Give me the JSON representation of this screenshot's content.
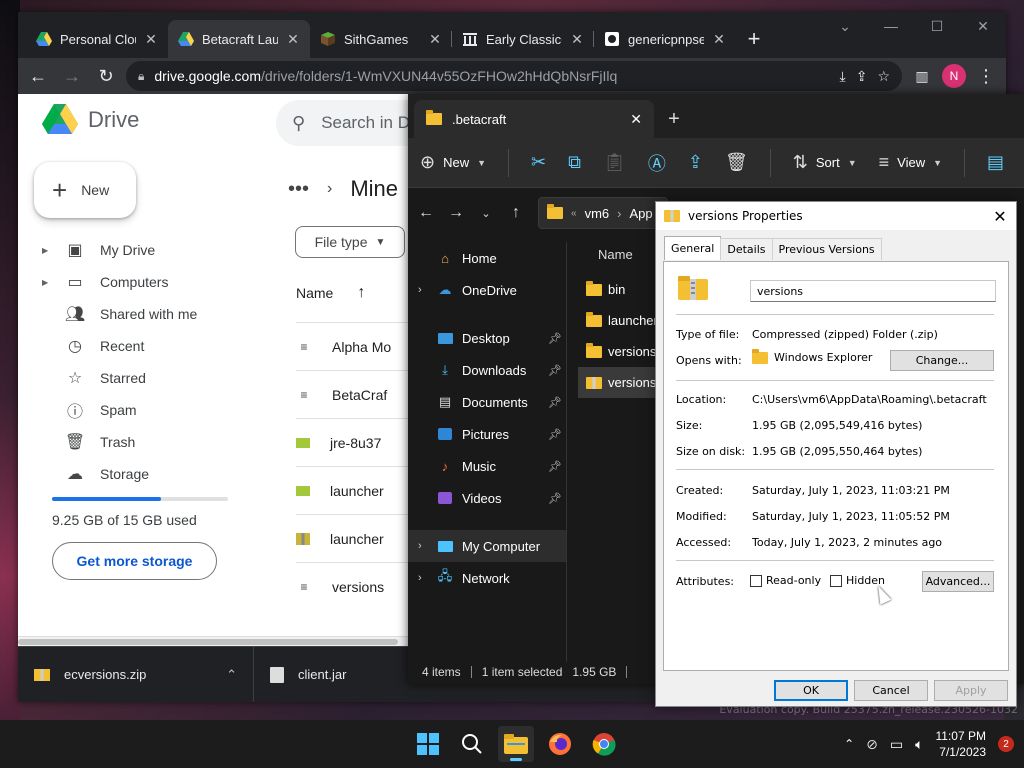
{
  "chrome": {
    "tabs": [
      {
        "title": "Personal Clouc"
      },
      {
        "title": "Betacraft Laun"
      },
      {
        "title": "SithGames"
      },
      {
        "title": "Early Classic+"
      },
      {
        "title": "genericpnpser"
      }
    ],
    "url_host": "drive.google.com",
    "url_path": "/drive/folders/1-WmVXUN44v55OzFHOw2hHdQbNsrFjIlq",
    "profile_initial": "N"
  },
  "drive": {
    "logo_text": "Drive",
    "search_placeholder": "Search in D",
    "new_label": "New",
    "nav": [
      {
        "label": "My Drive",
        "icon": "my-drive-icon"
      },
      {
        "label": "Computers",
        "icon": "computers-icon"
      },
      {
        "label": "Shared with me",
        "icon": "shared-icon"
      },
      {
        "label": "Recent",
        "icon": "recent-icon"
      },
      {
        "label": "Starred",
        "icon": "star-icon"
      },
      {
        "label": "Spam",
        "icon": "spam-icon"
      },
      {
        "label": "Trash",
        "icon": "trash-icon"
      },
      {
        "label": "Storage",
        "icon": "cloud-icon"
      }
    ],
    "storage_used_fraction": 0.617,
    "storage_text": "9.25 GB of 15 GB used",
    "get_more_storage": "Get more storage",
    "breadcrumb_current": "Mine",
    "filter_file_type": "File type",
    "col_name": "Name",
    "files": [
      {
        "name": "Alpha Mo"
      },
      {
        "name": "BetaCraf"
      },
      {
        "name": "jre-8u37"
      },
      {
        "name": "launcher"
      },
      {
        "name": "launcher"
      },
      {
        "name": "versions"
      }
    ]
  },
  "downloads": [
    {
      "name": "ecversions.zip"
    },
    {
      "name": "client.jar"
    }
  ],
  "explorer": {
    "tab_title": ".betacraft",
    "cmd": {
      "new": "New",
      "sort": "Sort",
      "view": "View"
    },
    "address_parts": [
      "vm6",
      "App"
    ],
    "nav": [
      {
        "label": "Home",
        "pinned": false
      },
      {
        "label": "OneDrive",
        "pinned": false
      },
      {
        "label": "Desktop",
        "pinned": true
      },
      {
        "label": "Downloads",
        "pinned": true
      },
      {
        "label": "Documents",
        "pinned": true
      },
      {
        "label": "Pictures",
        "pinned": true
      },
      {
        "label": "Music",
        "pinned": true
      },
      {
        "label": "Videos",
        "pinned": true
      },
      {
        "label": "My Computer",
        "pinned": false
      },
      {
        "label": "Network",
        "pinned": false
      }
    ],
    "col_name": "Name",
    "items": [
      {
        "name": "bin",
        "type": "folder"
      },
      {
        "name": "launcher",
        "type": "folder"
      },
      {
        "name": "versions",
        "type": "folder"
      },
      {
        "name": "versions",
        "type": "zip"
      }
    ],
    "status": {
      "count": "4 items",
      "selected": "1 item selected",
      "size": "1.95 GB"
    }
  },
  "properties": {
    "title": "versions Properties",
    "tabs": [
      "General",
      "Details",
      "Previous Versions"
    ],
    "name": "versions",
    "type_label": "Type of file:",
    "type_value": "Compressed (zipped) Folder (.zip)",
    "opens_label": "Opens with:",
    "opens_value": "Windows Explorer",
    "change_button": "Change...",
    "location_label": "Location:",
    "location_value": "C:\\Users\\vm6\\AppData\\Roaming\\.betacraft",
    "size_label": "Size:",
    "size_value": "1.95 GB (2,095,549,416 bytes)",
    "size_disk_label": "Size on disk:",
    "size_disk_value": "1.95 GB (2,095,550,464 bytes)",
    "created_label": "Created:",
    "created_value": "Saturday, July 1, 2023, 11:03:21 PM",
    "modified_label": "Modified:",
    "modified_value": "Saturday, July 1, 2023, 11:05:52 PM",
    "accessed_label": "Accessed:",
    "accessed_value": "Today, July 1, 2023, 2 minutes ago",
    "attributes_label": "Attributes:",
    "readonly_label": "Read-only",
    "hidden_label": "Hidden",
    "advanced_button": "Advanced...",
    "ok": "OK",
    "cancel": "Cancel",
    "apply": "Apply"
  },
  "taskbar": {
    "time": "11:07 PM",
    "date": "7/1/2023",
    "notification_count": "2"
  },
  "wallpaper_watermark": "Evaluation copy. Build 25375.zn_release.230526-1032"
}
